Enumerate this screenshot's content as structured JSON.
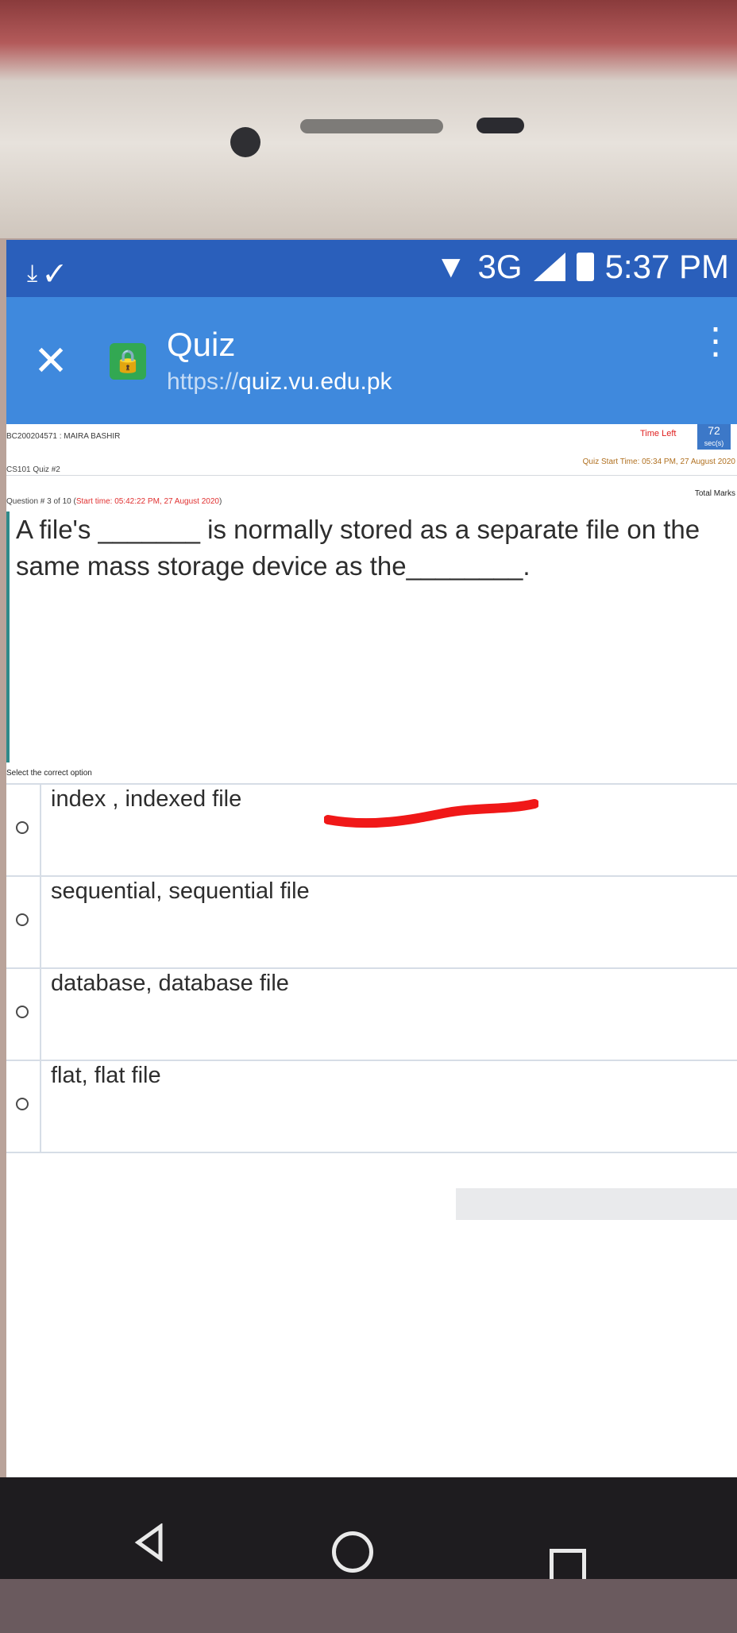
{
  "status_bar": {
    "network": "3G",
    "time": "5:37 PM",
    "left_icons": [
      "download-icon",
      "check-icon"
    ]
  },
  "browser": {
    "title": "Quiz",
    "url_scheme": "https://",
    "url_host": "quiz.vu.edu.pk",
    "icons": [
      "close-icon",
      "lock-icon",
      "menu-icon"
    ]
  },
  "quiz": {
    "student_id": "BC200204571 : MAIRA BASHIR",
    "course_quiz": "CS101 Quiz #2",
    "time_left_label": "Time Left",
    "time_left_value": "72",
    "time_left_unit": "sec(s)",
    "quiz_start_time": "Quiz Start Time: 05:34 PM, 27 August 2020",
    "total_marks": "Total Marks",
    "question_number": "Question # 3 of 10 (",
    "question_start_time": "Start time: 05:42:22 PM, 27 August 2020",
    "question_suffix": ")",
    "question_text": "A file's _______ is normally stored as a separate file on the same mass storage device as the________.",
    "select_prompt": "Select the correct option",
    "options": [
      {
        "label": "index , indexed file"
      },
      {
        "label": "sequential, sequential file"
      },
      {
        "label": "database, database file"
      },
      {
        "label": "flat, flat file"
      }
    ]
  },
  "navigation": {
    "icons": [
      "back-icon",
      "home-icon",
      "recents-icon"
    ]
  },
  "colors": {
    "status_bar": "#2a5fbb",
    "browser_header": "#3f89dd",
    "lock_badge": "#32a852",
    "timer_badge": "#3c78c8",
    "red_annotation": "#f01818"
  }
}
